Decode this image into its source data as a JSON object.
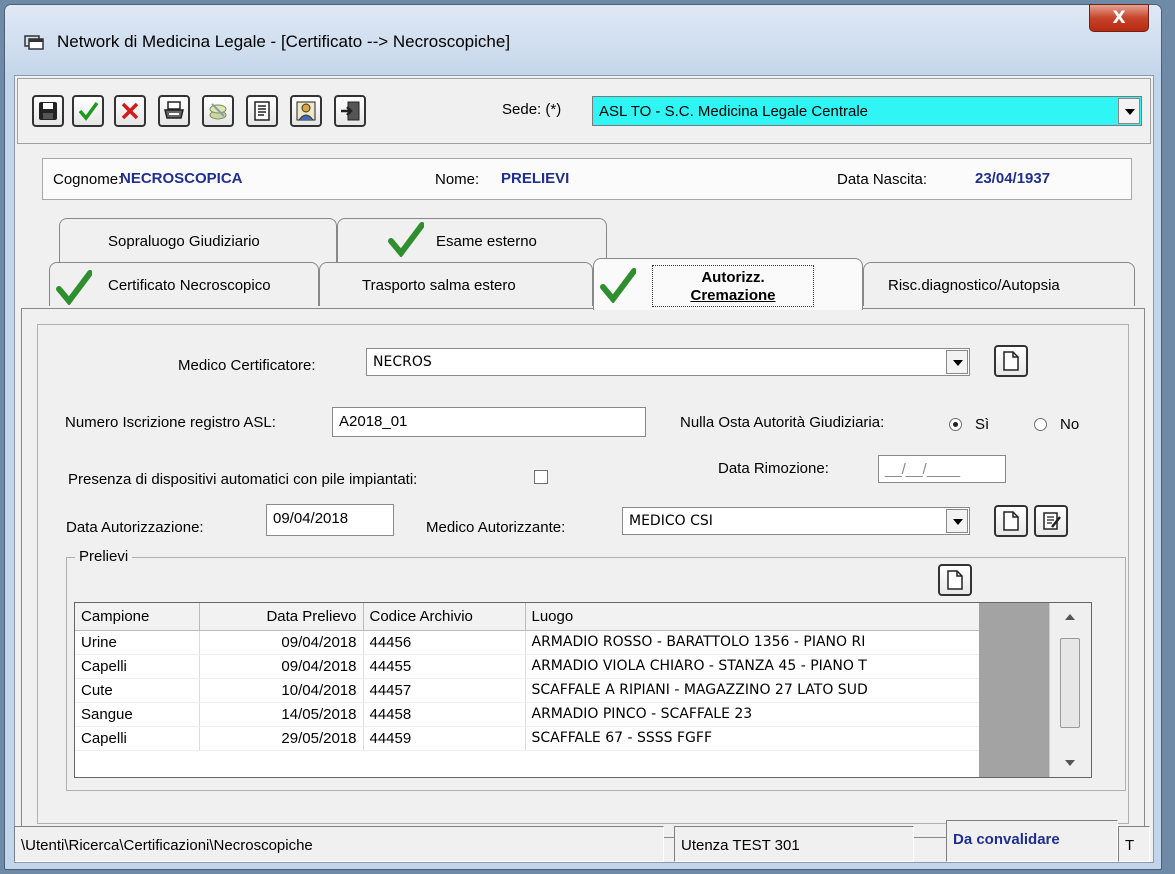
{
  "window": {
    "title": "Network di Medicina Legale - [Certificato --> Necroscopiche]",
    "close_label": "X"
  },
  "toolbar": {
    "buttons": [
      "save-icon",
      "confirm-check-icon",
      "cancel-x-icon",
      "print-icon",
      "money-icon",
      "document-icon",
      "user-icon",
      "exit-door-icon"
    ],
    "sede_label": "Sede: (*)",
    "sede_value": "ASL TO - S.C. Medicina Legale Centrale",
    "sede_color": "#2ff5f5"
  },
  "patient": {
    "cognome_label": "Cognome:",
    "cognome": "NECROSCOPICA",
    "nome_label": "Nome:",
    "nome": "PRELIEVI",
    "nascita_label": "Data Nascita:",
    "nascita": "23/04/1937"
  },
  "tabs": {
    "row1": [
      "Sopraluogo Giudiziario",
      "Esame esterno"
    ],
    "row2": [
      "Certificato Necroscopico",
      "Trasporto salma estero",
      "Autorizz.",
      "Cremazione",
      "Risc.diagnostico/Autopsia"
    ]
  },
  "form": {
    "medico_cert_label": "Medico Certificatore:",
    "medico_cert_value": "NECROS",
    "num_iscr_label": "Numero Iscrizione registro ASL:",
    "num_iscr_value": "A2018_01",
    "nulla_osta_label": "Nulla Osta Autorità Giudiziaria:",
    "si_label": "Sì",
    "no_label": "No",
    "si_selected": true,
    "dispositivi_label": "Presenza di dispositivi automatici con pile impiantati:",
    "dispositivi_checked": false,
    "rimozione_label": "Data Rimozione:",
    "rimozione_value": "__/__/____",
    "data_aut_label": "Data Autorizzazione:",
    "data_aut_value": "09/04/2018",
    "medico_aut_label": "Medico Autorizzante:",
    "medico_aut_value": "MEDICO CSI"
  },
  "prelievi": {
    "title": "Prelievi",
    "columns": [
      "Campione",
      "Data Prelievo",
      "Codice Archivio",
      "Luogo"
    ],
    "rows": [
      [
        "Urine",
        "09/04/2018",
        "44456",
        "ARMADIO ROSSO - BARATTOLO 1356 - PIANO RI"
      ],
      [
        "Capelli",
        "09/04/2018",
        "44455",
        "ARMADIO VIOLA CHIARO - STANZA 45 - PIANO T"
      ],
      [
        "Cute",
        "10/04/2018",
        "44457",
        "SCAFFALE A RIPIANI - MAGAZZINO 27 LATO SUD"
      ],
      [
        "Sangue",
        "14/05/2018",
        "44458",
        "ARMADIO PINCO - SCAFFALE 23"
      ],
      [
        "Capelli",
        "29/05/2018",
        "44459",
        "SCAFFALE 67 - SSSS FGFF"
      ]
    ]
  },
  "status": {
    "path": "\\Utenti\\Ricerca\\Certificazioni\\Necroscopiche",
    "utenza": "Utenza TEST 301",
    "stato": "Da convalidare",
    "extra": "T",
    "stato_color": "#1f2f8f"
  }
}
